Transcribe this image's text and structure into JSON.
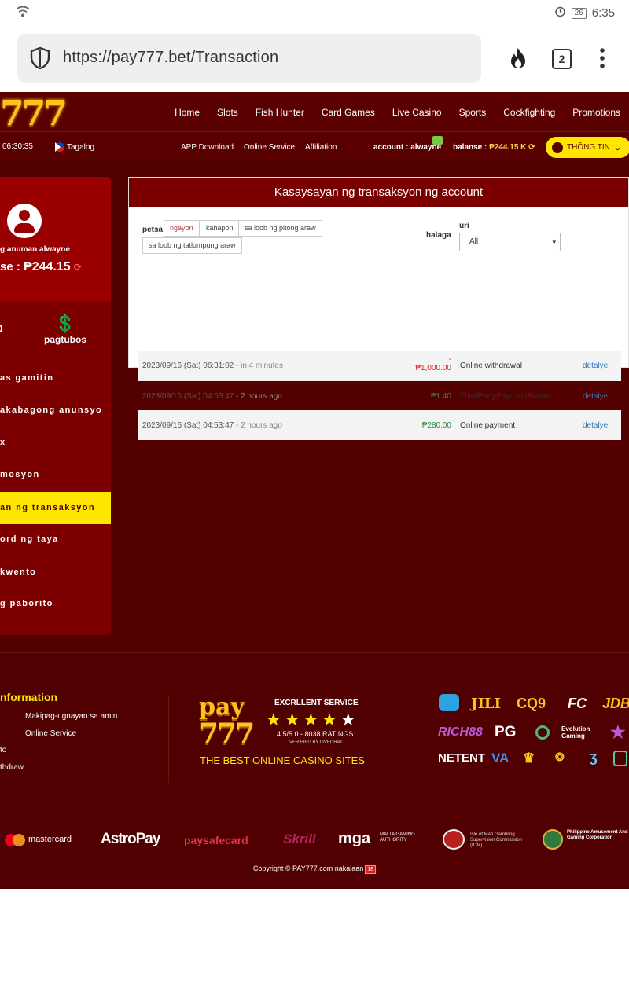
{
  "status_bar": {
    "battery": "26",
    "time": "6:35"
  },
  "browser": {
    "url": "https://pay777.bet/Transaction",
    "tab_count": "2"
  },
  "site": {
    "logo": "777",
    "nav": [
      "Home",
      "Slots",
      "Fish Hunter",
      "Card Games",
      "Live Casino",
      "Sports",
      "Cockfighting",
      "Promotions"
    ],
    "subbar": {
      "time": "06:30:35",
      "language": "Tagalog",
      "links": [
        "APP Download",
        "Online Service",
        "Affiliation"
      ],
      "account_label": "account : alwayne",
      "balance_label": "balanse :",
      "balance_value": "₱244.15 K",
      "info_button": "THÔNG TIN"
    },
    "sidebar": {
      "username": "g anuman alwayne",
      "balance_label": "se :",
      "balance_value": "₱244.15",
      "withdraw_label": "pagtubos",
      "items": [
        "as gamitin",
        "akabagong anunsyo",
        "x",
        "mosyon",
        "an ng transaksyon",
        "ord ng taya",
        "kwento",
        "g paborito"
      ]
    },
    "panel": {
      "title": "Kasaysayan ng transaksyon ng account",
      "filter_label": "petsa",
      "filters": [
        "ngayon",
        "kahapon",
        "sa loob ng pitong araw",
        "sa loob ng tatlumpung araw"
      ],
      "amount_label": "halaga",
      "type_label": "uri",
      "type_selected": "All",
      "rows": [
        {
          "date": "2023/09/16 (Sat) 06:31:02",
          "ago": "- in 4 minutes",
          "sign": "-",
          "amount": "₱1,000.00",
          "type": "Online withdrawal",
          "link": "detalye"
        },
        {
          "date": "2023/09/16 (Sat) 04:53:47",
          "ago": "- 2 hours ago",
          "sign": "",
          "amount": "₱1.40",
          "type": "ThirdPartyPaymentBonus",
          "link": "detalye"
        },
        {
          "date": "2023/09/16 (Sat) 04:53:47",
          "ago": "- 2 hours ago",
          "sign": "",
          "amount": "₱280.00",
          "type": "Online payment",
          "link": "detalye"
        }
      ]
    },
    "footer": {
      "info_title": "nformation",
      "links_left": [
        "to",
        "thdraw"
      ],
      "links_right": [
        "Makipag-ugnayan sa amin",
        "Online Service"
      ],
      "brand_top": "pay",
      "brand_bottom": "777",
      "excellent": "EXCRLLENT SERVICE",
      "ratings": "4.5/5.0 - 8038 RATINGS",
      "verified": "VERIFIED BY LIVECHAT",
      "tagline": "THE BEST ONLINE CASINO SITES",
      "providers": [
        "JILI",
        "CQ9",
        "FC",
        "JDB",
        "RICH88",
        "PG",
        "Evolution Gaming",
        "NETENT",
        "VA"
      ],
      "payments": [
        "mastercard",
        "AstroPay",
        "paysafecard",
        "Skrill",
        "mga",
        "MALTA GAMING AUTHORITY",
        "Isle of Man Gambling Supervision Commission (IOM)",
        "Philippine Amusement And Gaming Corporation"
      ],
      "copyright": "Copyright © PAY777.com nakalaan",
      "age": "18"
    }
  }
}
